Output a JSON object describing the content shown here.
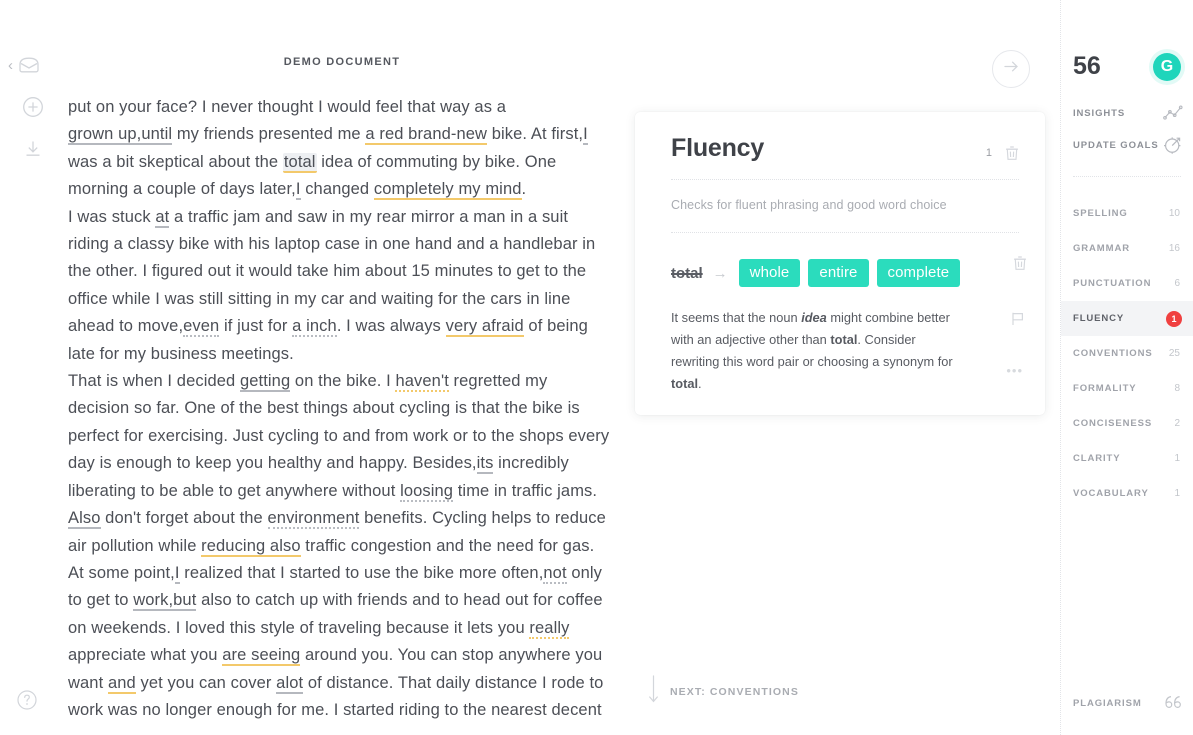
{
  "left_rail": {
    "back_chevron": "‹",
    "icons": [
      "mail-icon",
      "add-circle-icon",
      "download-icon",
      "help-circle-icon"
    ]
  },
  "document": {
    "title": "DEMO DOCUMENT",
    "paragraphs": [
      [
        {
          "t": "put on your face? I never thought I would feel that way as a "
        },
        {
          "t": "grown up,until",
          "mark": "gray"
        },
        {
          "t": " my friends presented me "
        },
        {
          "t": "a red brand-new",
          "mark": "amber"
        },
        {
          "t": " bike. At first,",
          "mark": ""
        },
        {
          "t": "I",
          "mark": "gray"
        },
        {
          "t": " was a bit skeptical about the "
        },
        {
          "t": "total",
          "mark": "active"
        },
        {
          "t": " idea of commuting by bike. One morning a couple of days later,"
        },
        {
          "t": "I",
          "mark": "gray"
        },
        {
          "t": " changed "
        },
        {
          "t": "completely my mind",
          "mark": "amber"
        },
        {
          "t": "."
        }
      ],
      [
        {
          "t": "I was stuck "
        },
        {
          "t": "at",
          "mark": "gray"
        },
        {
          "t": " a traffic jam and saw in my rear mirror a man in a suit riding a classy bike with his laptop case in one hand and a handlebar in the other. I figured out it would take him about 15 minutes to get to the office while I was still sitting in my car and waiting for the cars in line ahead to move,"
        },
        {
          "t": "even",
          "mark": "gray-d"
        },
        {
          "t": " if just for "
        },
        {
          "t": "a inch",
          "mark": "gray-d"
        },
        {
          "t": ". I was always "
        },
        {
          "t": "very afraid",
          "mark": "amber"
        },
        {
          "t": " of being late for my business meetings."
        }
      ],
      [
        {
          "t": "That is when I decided "
        },
        {
          "t": "getting",
          "mark": "gray"
        },
        {
          "t": " on the bike. I "
        },
        {
          "t": "haven't",
          "mark": "amber-d"
        },
        {
          "t": " regretted my decision so far. One of the best things about cycling is that the bike is perfect for exercising. Just cycling to and from work or to the shops every day is enough to keep you healthy and happy. Besides,"
        },
        {
          "t": "its",
          "mark": "gray"
        },
        {
          "t": " incredibly liberating to be able to get anywhere without "
        },
        {
          "t": "loosing",
          "mark": "gray-d"
        },
        {
          "t": " time in traffic jams. "
        },
        {
          "t": "Also",
          "mark": "gray"
        },
        {
          "t": " don't forget about the "
        },
        {
          "t": "environment",
          "mark": "gray-d"
        },
        {
          "t": " benefits. Cycling helps to reduce air pollution while "
        },
        {
          "t": "reducing also",
          "mark": "amber"
        },
        {
          "t": " traffic congestion and the need for gas."
        }
      ],
      [
        {
          "t": "At some point,"
        },
        {
          "t": "I",
          "mark": "gray"
        },
        {
          "t": " realized that I started to use the bike more often,"
        },
        {
          "t": "not",
          "mark": "gray-d"
        },
        {
          "t": " only to get to "
        },
        {
          "t": "work,but",
          "mark": "gray"
        },
        {
          "t": " also to catch up with friends and to head out for coffee on weekends. I loved this style of traveling because it lets you "
        },
        {
          "t": "really",
          "mark": "amber-d"
        },
        {
          "t": " appreciate what you "
        },
        {
          "t": "are seeing",
          "mark": "amber"
        },
        {
          "t": " around you. You can stop anywhere you want "
        },
        {
          "t": "and",
          "mark": "amber"
        },
        {
          "t": " yet you can cover "
        },
        {
          "t": "alot",
          "mark": "gray"
        },
        {
          "t": " of distance. That daily distance I rode to work was no longer enough for me. I started riding to the nearest decent"
        }
      ]
    ]
  },
  "card_panel": {
    "next_arrow_icon": "arrow-right-icon",
    "card": {
      "title": "Fluency",
      "count": "1",
      "delete_icon": "trash-icon",
      "description": "Checks for fluent phrasing and good word choice",
      "suggestion": {
        "original": "total",
        "arrow": "→",
        "replacements": [
          "whole",
          "entire",
          "complete"
        ],
        "delete_icon": "trash-icon",
        "explanation_parts": [
          {
            "t": "It seems that the noun "
          },
          {
            "t": "idea",
            "style": "italic-bold"
          },
          {
            "t": " might combine better with an adjective other than "
          },
          {
            "t": "total",
            "style": "bold"
          },
          {
            "t": ". Consider rewriting this word pair or choosing a synonym for "
          },
          {
            "t": "total",
            "style": "bold"
          },
          {
            "t": "."
          }
        ],
        "flag_icon": "flag-icon",
        "more_dots": "•••"
      }
    },
    "next_section": {
      "arrow_icon": "arrow-down-icon",
      "label": "NEXT: CONVENTIONS"
    }
  },
  "right_panel": {
    "score": "56",
    "brand_badge": "G",
    "tools": [
      {
        "label": "INSIGHTS",
        "icon": "line-chart-icon"
      },
      {
        "label": "UPDATE GOALS",
        "icon": "target-icon"
      }
    ],
    "categories": [
      {
        "label": "SPELLING",
        "count": "10",
        "active": false
      },
      {
        "label": "GRAMMAR",
        "count": "16",
        "active": false
      },
      {
        "label": "PUNCTUATION",
        "count": "6",
        "active": false
      },
      {
        "label": "FLUENCY",
        "count": "1",
        "active": true
      },
      {
        "label": "CONVENTIONS",
        "count": "25",
        "active": false
      },
      {
        "label": "FORMALITY",
        "count": "8",
        "active": false
      },
      {
        "label": "CONCISENESS",
        "count": "2",
        "active": false
      },
      {
        "label": "CLARITY",
        "count": "1",
        "active": false
      },
      {
        "label": "VOCABULARY",
        "count": "1",
        "active": false
      }
    ],
    "plagiarism": {
      "label": "PLAGIARISM",
      "icon": "quote-icon"
    }
  },
  "colors": {
    "accent_teal": "#2bdcbd",
    "badge_teal": "#1fd5bb",
    "alert_red": "#f04040",
    "amber_underline": "#f3c96b",
    "gray_underline": "#b5b8be",
    "text": "#4c4f56"
  }
}
